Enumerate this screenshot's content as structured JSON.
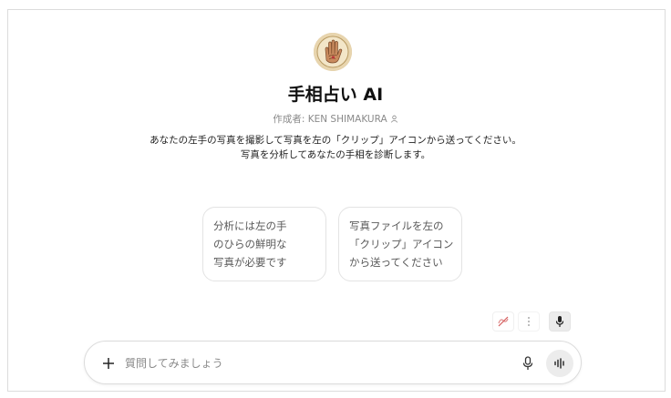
{
  "gpt": {
    "title": "手相占い AI",
    "author": "作成者: KEN SHIMAKURA",
    "description_line1": "あなたの左手の写真を撮影して写真を左の「クリップ」アイコンから送ってください。",
    "description_line2": "写真を分析してあなたの手相を診断します。",
    "avatar_icon": "palm-reading-hand-icon"
  },
  "suggestions": [
    {
      "lines": [
        "分析には左の手",
        "のひらの鮮明な",
        "写真が必要です"
      ]
    },
    {
      "lines": [
        "写真ファイルを左の",
        "「クリップ」アイコン",
        "から送ってください"
      ]
    }
  ],
  "composer": {
    "placeholder": "質問してみましょう",
    "value": ""
  },
  "icons": {
    "add": "plus-icon",
    "mic": "microphone-icon",
    "voice": "voice-mode-icon",
    "extension": "muted-extension-icon",
    "more": "more-vertical-icon",
    "person": "person-icon"
  },
  "colors": {
    "text": "#1f1f1f",
    "muted": "#8a8a8a",
    "border": "#dcdcdc",
    "button_bg": "#ececec"
  }
}
